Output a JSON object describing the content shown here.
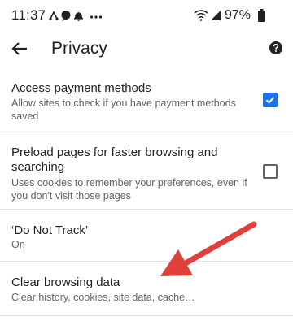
{
  "status_bar": {
    "time": "11:37",
    "battery_percent": "97%",
    "icons": [
      "link-icon",
      "chat-bubble-icon",
      "notification-bell-icon",
      "more-dots-icon",
      "wifi-icon",
      "signal-icon",
      "battery-icon"
    ]
  },
  "app_bar": {
    "title": "Privacy",
    "back_icon": "arrow-left-icon",
    "help_icon": "help-circle-icon"
  },
  "settings": [
    {
      "title": "Access payment methods",
      "summary": "Allow sites to check if you have payment methods saved",
      "checked": true
    },
    {
      "title": "Preload pages for faster browsing and searching",
      "summary": "Uses cookies to remember your preferences, even if you don't visit those pages",
      "checked": false
    },
    {
      "title": "‘Do Not Track’",
      "summary": "On"
    },
    {
      "title": "Clear browsing data",
      "summary": "Clear history, cookies, site data, cache…"
    }
  ],
  "colors": {
    "accent": "#1a73e8",
    "annotation_arrow": "#e0403a",
    "text_primary": "#202124",
    "text_secondary": "#5f6368"
  }
}
